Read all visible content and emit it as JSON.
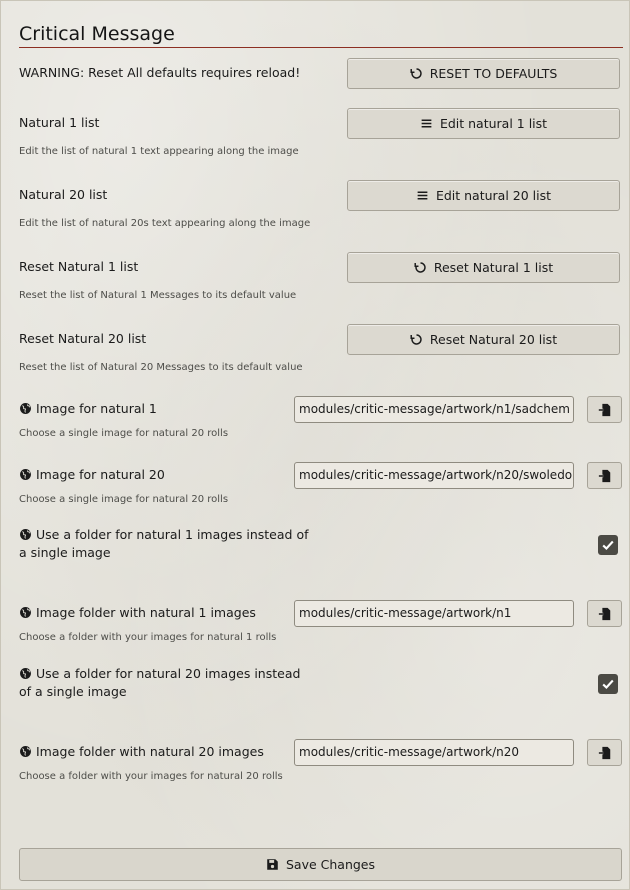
{
  "section": {
    "title": "Critical Message"
  },
  "warning": {
    "label": "WARNING: Reset All defaults requires reload!",
    "button": "RESET TO DEFAULTS"
  },
  "nat1_list": {
    "label": "Natural 1 list",
    "hint": "Edit the list of natural 1 text appearing along the image",
    "button": "Edit natural 1 list"
  },
  "nat20_list": {
    "label": "Natural 20 list",
    "hint": "Edit the list of natural 20s text appearing along the image",
    "button": "Edit natural 20 list"
  },
  "reset_nat1": {
    "label": "Reset Natural 1 list",
    "hint": "Reset the list of Natural 1 Messages to its default value",
    "button": "Reset Natural 1 list"
  },
  "reset_nat20": {
    "label": "Reset Natural 20 list",
    "hint": "Reset the list of Natural 20 Messages to its default value",
    "button": "Reset Natural 20 list"
  },
  "img_nat1": {
    "label": "Image for natural 1",
    "hint": "Choose a single image for natural 20 rolls",
    "value": "modules/critic-message/artwork/n1/sadchem"
  },
  "img_nat20": {
    "label": "Image for natural 20",
    "hint": "Choose a single image for natural 20 rolls",
    "value": "modules/critic-message/artwork/n20/swoledo"
  },
  "folder_nat1_toggle": {
    "label_line1": "Use a folder for natural 1 images instead of",
    "label_line2": "a single image",
    "checked": true
  },
  "folder_nat1": {
    "label": "Image folder with natural 1 images",
    "hint": "Choose a folder with your images for natural 1 rolls",
    "value": "modules/critic-message/artwork/n1"
  },
  "folder_nat20_toggle": {
    "label_line1": "Use a folder for natural 20 images instead",
    "label_line2": "of a single image",
    "checked": true
  },
  "folder_nat20": {
    "label": "Image folder with natural 20 images",
    "hint": "Choose a folder with your images for natural 20 rolls",
    "value": "modules/critic-message/artwork/n20"
  },
  "save": {
    "label": "Save Changes"
  },
  "colors": {
    "accent_rule": "#8c2f22",
    "checkbox": "#4b4a44"
  }
}
